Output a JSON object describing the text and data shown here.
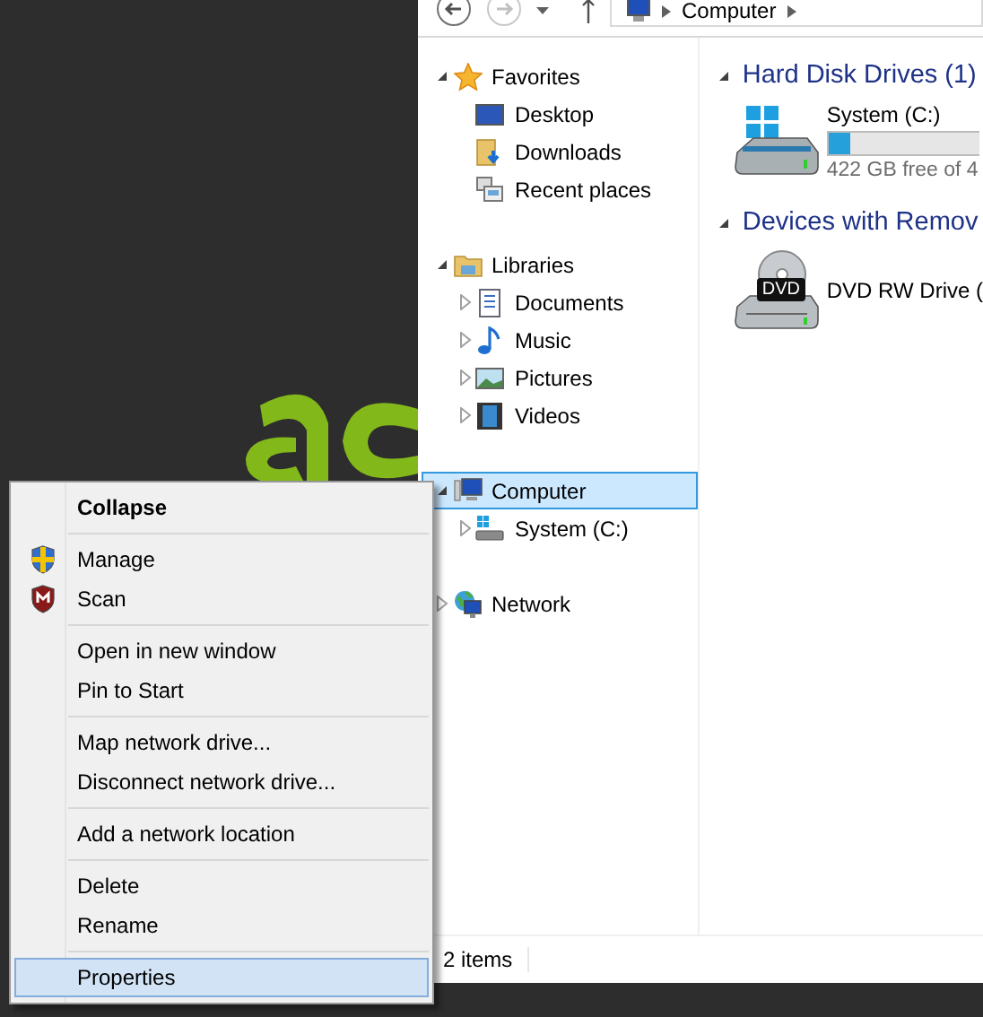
{
  "toolbar": {
    "address": "Computer"
  },
  "navigation": [
    {
      "label": "Favorites",
      "expanded": true,
      "selected": false,
      "children": [
        {
          "label": "Desktop",
          "selected": false
        },
        {
          "label": "Downloads",
          "selected": false
        },
        {
          "label": "Recent places",
          "selected": false
        }
      ]
    },
    {
      "label": "Libraries",
      "expanded": true,
      "selected": false,
      "children": [
        {
          "label": "Documents",
          "expanded": false,
          "selected": false
        },
        {
          "label": "Music",
          "expanded": false,
          "selected": false
        },
        {
          "label": "Pictures",
          "expanded": false,
          "selected": false
        },
        {
          "label": "Videos",
          "expanded": false,
          "selected": false
        }
      ]
    },
    {
      "label": "Computer",
      "expanded": true,
      "selected": true,
      "children": [
        {
          "label": "System (C:)",
          "expanded": false,
          "selected": false
        }
      ]
    },
    {
      "label": "Network",
      "expanded": false,
      "selected": false
    }
  ],
  "content": [
    {
      "title": "Hard Disk Drives (1)",
      "expanded": true,
      "items": [
        {
          "kind": "disk",
          "name": "System (C:)",
          "level": 0.14,
          "free": "422 GB free of 4"
        }
      ]
    },
    {
      "title": "Devices with Remov",
      "expanded": true,
      "items": [
        {
          "kind": "optical",
          "name": "DVD RW Drive (",
          "badge": "DVD"
        }
      ]
    }
  ],
  "status_bar": {
    "count": "2 items"
  },
  "context_menu": {
    "sections": [
      [
        {
          "label": "Collapse",
          "default": true,
          "selected": false
        }
      ],
      [
        {
          "label": "Manage",
          "default": false,
          "selected": false
        },
        {
          "label": "Scan",
          "default": false,
          "selected": false
        }
      ],
      [
        {
          "label": "Open in new window",
          "default": false,
          "selected": false
        },
        {
          "label": "Pin to Start",
          "default": false,
          "selected": false
        }
      ],
      [
        {
          "label": "Map network drive...",
          "default": false,
          "selected": false
        },
        {
          "label": "Disconnect network drive...",
          "default": false,
          "selected": false
        }
      ],
      [
        {
          "label": "Add a network location",
          "default": false,
          "selected": false
        }
      ],
      [
        {
          "label": "Delete",
          "default": false,
          "selected": false
        },
        {
          "label": "Rename",
          "default": false,
          "selected": false
        }
      ],
      [
        {
          "label": "Properties",
          "default": false,
          "selected": true
        }
      ]
    ]
  }
}
